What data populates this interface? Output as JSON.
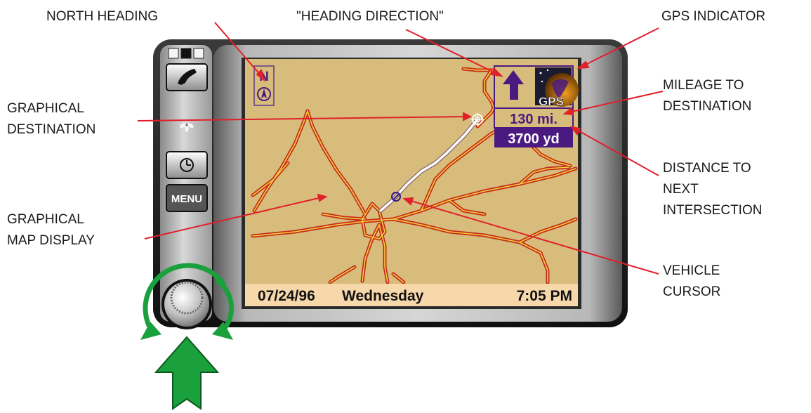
{
  "callouts": {
    "north_heading": "NORTH HEADING",
    "heading_direction": "\"HEADING DIRECTION\"",
    "gps_indicator": "GPS INDICATOR",
    "mileage_line1": "MILEAGE TO",
    "mileage_line2": "DESTINATION",
    "graphical_destination_line1": "GRAPHICAL",
    "graphical_destination_line2": "DESTINATION",
    "distance_line1": "DISTANCE  TO",
    "distance_line2": "NEXT",
    "distance_line3": "INTERSECTION",
    "map_display_line1": "GRAPHICAL",
    "map_display_line2": "MAP DISPLAY",
    "vehicle_line1": "VEHICLE",
    "vehicle_line2": "CURSOR"
  },
  "screen": {
    "north_letter": "N",
    "gps_label": "GPS",
    "mileage": "130 mi.",
    "distance": "3700 yd",
    "date": "07/24/96",
    "day": "Wednesday",
    "time": "7:05 PM"
  },
  "buttons": {
    "menu_label": "MENU"
  },
  "colors": {
    "map_background": "#d8bc7c",
    "road_outline": "#c62a1e",
    "road_fill": "#f2d23a",
    "route": "#ffffff",
    "info_panel": "#4b1a80",
    "status_bar": "#f6d8aa",
    "arrow_green": "#1aa03c",
    "callout_line": "#e0202a",
    "bezel": "#1a1a1a"
  },
  "icons": [
    "telephone-icon",
    "fan-icon",
    "clock-icon",
    "compass-icon",
    "heading-arrow-icon",
    "gps-satellite-icon",
    "destination-flag-icon",
    "vehicle-cursor-icon",
    "rotate-arrows-icon",
    "push-arrow-icon"
  ]
}
